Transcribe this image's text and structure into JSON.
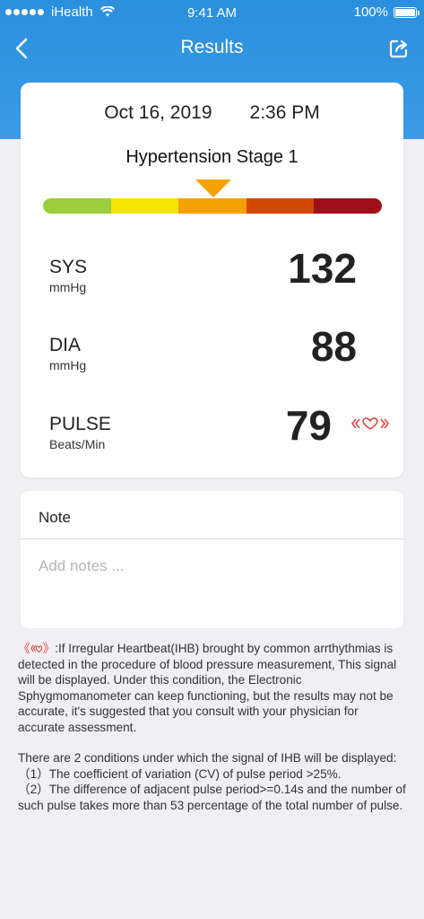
{
  "status_bar": {
    "carrier": "iHealth",
    "time": "9:41 AM",
    "battery": "100%"
  },
  "nav": {
    "title": "Results",
    "back_icon": "chevron-left-icon",
    "share_icon": "share-icon"
  },
  "result": {
    "date": "Oct 16, 2019",
    "time": "2:36 PM",
    "stage": "Hypertension Stage 1",
    "scale_colors": [
      "#9ccd3b",
      "#f5e400",
      "#f5a100",
      "#d44700",
      "#a0101a"
    ],
    "marker_color": "#f5a100",
    "active_segment": 3
  },
  "metrics": {
    "sys": {
      "label": "SYS",
      "unit": "mmHg",
      "value": "132"
    },
    "dia": {
      "label": "DIA",
      "unit": "mmHg",
      "value": "88"
    },
    "pulse": {
      "label": "PULSE",
      "unit": "Beats/Min",
      "value": "79",
      "ihb_icon": "irregular-heartbeat-icon"
    }
  },
  "note": {
    "title": "Note",
    "placeholder": "Add notes ..."
  },
  "info": {
    "ihb_desc": ":If Irregular Heartbeat(IHB) brought by common arrthythmias is detected in the procedure of blood pressure measurement, This signal  will be displayed. Under this condition, the Electronic Sphygmomanometer can keep functioning, but the results may not be accurate, it's suggested that you consult with your physician for accurate assessment.",
    "conditions_intro": "There are 2 conditions under which the signal of IHB will be displayed:",
    "condition_1": "（1）The coefficient of variation (CV) of pulse period >25%.",
    "condition_2": "（2）The difference of adjacent pulse period>=0.14s and the number of such pulse takes more than 53 percentage of the total number of pulse."
  },
  "colors": {
    "header_blue": "#2a8fde",
    "ihb_red": "#e04646",
    "background": "#efeff4"
  }
}
